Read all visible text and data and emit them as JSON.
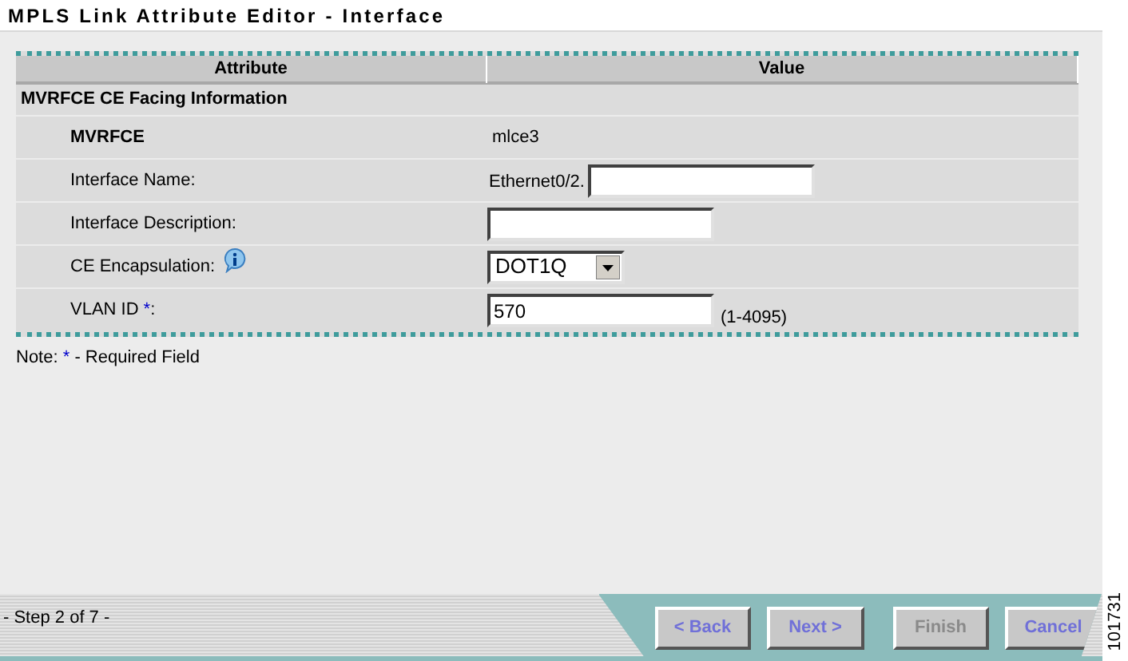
{
  "window": {
    "title": "MPLS Link Attribute Editor - Interface"
  },
  "table": {
    "columns": [
      "Attribute",
      "Value"
    ],
    "section": "MVRFCE CE Facing Information",
    "rows": [
      {
        "kind": "text",
        "label": "MVRFCE",
        "value": "mlce3"
      },
      {
        "kind": "prefixed-input",
        "label": "Interface Name:",
        "prefix": "Ethernet0/2."
      },
      {
        "kind": "input",
        "label": "Interface Description:"
      },
      {
        "kind": "select",
        "label": "CE Encapsulation:",
        "info": true,
        "value": "DOT1Q"
      },
      {
        "kind": "input",
        "label": "VLAN ID",
        "required": "*",
        "label_suffix": ":",
        "value": "570",
        "hint": "(1-4095)"
      }
    ]
  },
  "note": {
    "label": "Note:",
    "mark": "*",
    "text": "- Required Field"
  },
  "status": "- Step 2 of 7 -",
  "buttons": [
    {
      "label": "< Back",
      "disabled": false
    },
    {
      "label": "Next >",
      "disabled": false
    },
    {
      "label": "Finish",
      "disabled": true
    },
    {
      "label": "Cancel",
      "disabled": false
    }
  ],
  "figure_id": "101731"
}
